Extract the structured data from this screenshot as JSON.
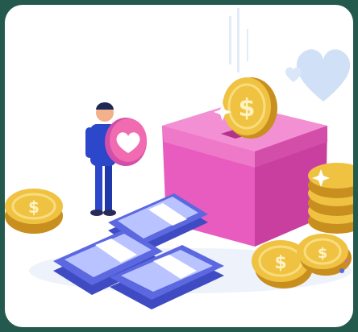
{
  "image": {
    "subject": "donation-box-illustration",
    "colors": {
      "background_frame": "#245a4d",
      "card": "#ffffff",
      "box_pink": "#e85bbf",
      "box_pink_dark": "#c93fa0",
      "box_pink_top": "#f38fd3",
      "coin_gold": "#f0c242",
      "coin_gold_dark": "#c98f1e",
      "cash_blue": "#5b68e0",
      "cash_blue_light": "#b9c3ff",
      "heart_light": "#cfe0f7",
      "heart_pink": "#f06bb0",
      "person_shirt": "#2c47c9",
      "person_skin": "#f2b18a"
    },
    "icons": [
      "coin-icon",
      "heart-icon",
      "dollar-icon",
      "sparkle-icon"
    ]
  }
}
